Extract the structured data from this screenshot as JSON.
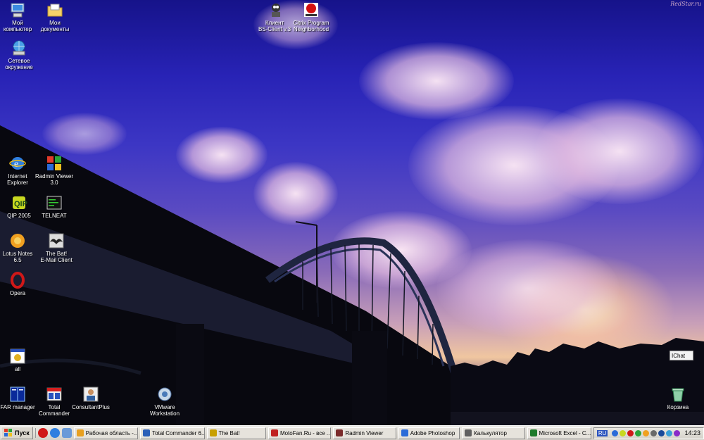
{
  "watermark": "RedStar.ru",
  "desktop_icons": [
    {
      "name": "my-computer-icon",
      "label": "Мой\nкомпьютер"
    },
    {
      "name": "my-documents-icon",
      "label": "Мои\nдокументы"
    },
    {
      "name": "network-icon",
      "label": "Сетевое\nокружение"
    },
    {
      "name": "bs-client-icon",
      "label": "Клиент\nBS-Client v.3"
    },
    {
      "name": "citrix-icon",
      "label": "Citrix Program\nNeighborhood"
    },
    {
      "name": "internet-explorer-icon",
      "label": "Internet\nExplorer"
    },
    {
      "name": "radmin-viewer-icon",
      "label": "Radmin Viewer\n3.0"
    },
    {
      "name": "qip-icon",
      "label": "QIP 2005"
    },
    {
      "name": "telneat-icon",
      "label": "TELNEAT"
    },
    {
      "name": "lotus-notes-icon",
      "label": "Lotus Notes\n6.5"
    },
    {
      "name": "the-bat-icon",
      "label": "The Bat!\nE-Mail Client"
    },
    {
      "name": "opera-icon",
      "label": "Opera"
    },
    {
      "name": "all-icon",
      "label": "all"
    },
    {
      "name": "far-manager-icon",
      "label": "FAR manager"
    },
    {
      "name": "total-commander-icon",
      "label": "Total\nCommander"
    },
    {
      "name": "consultantplus-icon",
      "label": "ConsultantPlus"
    },
    {
      "name": "vmware-icon",
      "label": "VMware\nWorkstation"
    },
    {
      "name": "recycle-bin-icon",
      "label": "Корзина"
    }
  ],
  "chat_popup": "IChat",
  "taskbar": {
    "start_label": "Пуск",
    "tasks": [
      {
        "label": "Рабочая область -...",
        "color": "#e8a020"
      },
      {
        "label": "Total Commander 6...",
        "color": "#2b5fb8"
      },
      {
        "label": "The Bat!",
        "color": "#c8a000"
      },
      {
        "label": "MotoFan.Ru - все ...",
        "color": "#c02020"
      },
      {
        "label": "Radmin Viewer",
        "color": "#7b2b2b"
      },
      {
        "label": "Adobe Photoshop",
        "color": "#2a6bd8"
      },
      {
        "label": "Калькулятор",
        "color": "#606060"
      },
      {
        "label": "Microsoft Excel - C...",
        "color": "#1d7a2a"
      }
    ],
    "language": "RU",
    "clock": "14:23"
  }
}
